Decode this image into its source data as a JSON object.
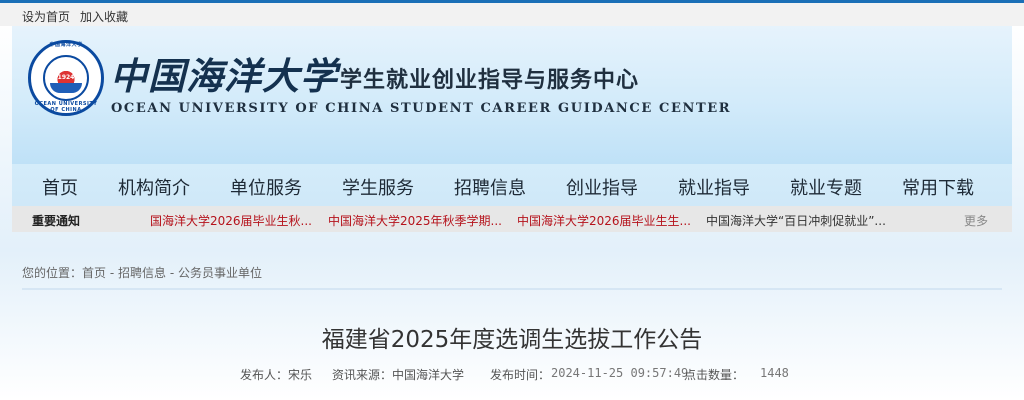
{
  "topbar": {
    "set_home": "设为首页",
    "add_favorite": "加入收藏"
  },
  "header": {
    "school_cn": "中国海洋大学",
    "center_cn": "学生就业创业指导与服务中心",
    "english": "OCEAN UNIVERSITY OF CHINA  STUDENT CAREER GUIDANCE CENTER",
    "seal_year": "1924",
    "seal_top": "中国海洋大学",
    "seal_bottom": "OCEAN UNIVERSITY OF CHINA"
  },
  "nav": {
    "items": [
      "首页",
      "机构简介",
      "单位服务",
      "学生服务",
      "招聘信息",
      "创业指导",
      "就业指导",
      "就业专题",
      "常用下载"
    ]
  },
  "notice": {
    "label": "重要通知",
    "items": [
      {
        "text": "国海洋大学2026届毕业生秋..."
      },
      {
        "text": "中国海洋大学2025年秋季学期..."
      },
      {
        "text": "中国海洋大学2026届毕业生生..."
      },
      {
        "text": "中国海洋大学“百日冲刺促就业”..."
      }
    ],
    "more": "更多"
  },
  "breadcrumb": {
    "prefix": "您的位置：",
    "home": "首页",
    "sep": " - ",
    "section": "招聘信息",
    "sub": "公务员事业单位"
  },
  "article": {
    "title": "福建省2025年度选调生选拔工作公告",
    "publisher_label": "发布人：",
    "publisher": "宋乐",
    "source_label": "资讯来源：",
    "source": "中国海洋大学",
    "time_label": "发布时间：",
    "time": "2024-11-25 09:57:49",
    "views_label": "点击数量：",
    "views": "1448"
  },
  "colors": {
    "accent": "#1a6fb7",
    "notice_red": "#b5121b",
    "notice_dark": "#333333"
  }
}
